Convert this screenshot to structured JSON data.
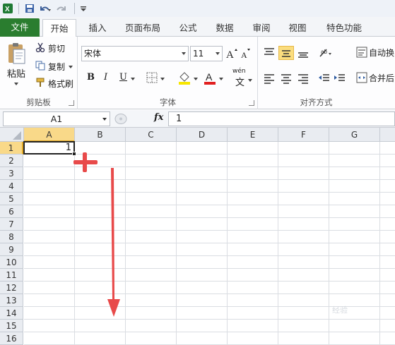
{
  "quick_access": {
    "icons": [
      "excel-logo-icon",
      "save-icon",
      "undo-icon",
      "redo-icon",
      "customize-icon"
    ]
  },
  "tabs": [
    {
      "label": "文件"
    },
    {
      "label": "开始"
    },
    {
      "label": "插入"
    },
    {
      "label": "页面布局"
    },
    {
      "label": "公式"
    },
    {
      "label": "数据"
    },
    {
      "label": "审阅"
    },
    {
      "label": "视图"
    },
    {
      "label": "特色功能"
    }
  ],
  "ribbon": {
    "clipboard": {
      "paste_label": "粘贴",
      "cut_label": "剪切",
      "copy_label": "复制",
      "format_painter_label": "格式刷",
      "group_label": "剪贴板"
    },
    "font": {
      "font_name": "宋体",
      "font_size": "11",
      "bold": "B",
      "italic": "I",
      "underline": "U",
      "font_color_letter": "A",
      "phonetic_label": "wén",
      "phonetic_char": "文",
      "group_label": "字体",
      "highlight_color": "#f7e600",
      "font_color": "#e12020"
    },
    "alignment": {
      "wrap_label": "自动换",
      "merge_label": "合并后",
      "group_label": "对齐方式"
    }
  },
  "formula_bar": {
    "name_box": "A1",
    "fx_label": "fx",
    "formula_value": "1"
  },
  "sheet": {
    "columns": [
      "A",
      "B",
      "C",
      "D",
      "E",
      "F",
      "G"
    ],
    "rows": [
      "1",
      "2",
      "3",
      "4",
      "5",
      "6",
      "7",
      "8",
      "9",
      "10",
      "11",
      "12",
      "13",
      "14",
      "15",
      "16"
    ],
    "selected_cell": "A1",
    "a1_value": "1"
  },
  "annotations": {
    "cross_color": "#e84a4a",
    "arrow_color": "#e84a4a"
  },
  "watermark": "经验"
}
